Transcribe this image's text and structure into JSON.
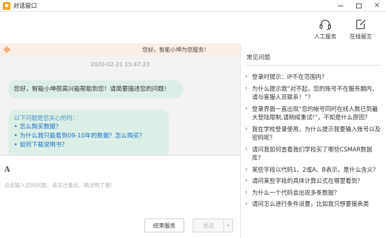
{
  "window": {
    "title": "对话窗口",
    "controls": [
      "minimize",
      "maximize",
      "close"
    ]
  },
  "header": {
    "manual_service_label": "人工服务",
    "leave_message_label": "在线留言"
  },
  "chat": {
    "notice": "您好，智能小坤为您服务！",
    "timestamp": "2020-02-21 15:47:23",
    "welcome": "您好，智能小坤很高兴能帮助到您！请简要描述您的问题！",
    "faq_title": "以下问题是您关心的吗：",
    "faq_links": [
      "怎么购买数据？",
      "为什么我只能看到09-10年的数据？怎么购买？",
      "如何下载说明书？"
    ]
  },
  "input": {
    "font_icon": "A",
    "placeholder": "点此输入您的问题，请突出重点，简洁明了哦！",
    "end_button": "结束服务",
    "send_button": "发送"
  },
  "faq_panel": {
    "title": "常见问题",
    "items": [
      "登录时提示：IP不在范围内？",
      "为什么提示我“对不起，您的账号不在服务期内，请与客服人员联系！”？",
      "登录界面一直出现“您的帐号同时在线人数已到最大登陆限制,请稍候重试!”，不知是什么原因?",
      "我在学校登录使用，为什么提示我要输入账号以及密码呢？",
      "请问我如何查看我们学校买了哪些CSMAR数据库？",
      "某些字段以代码1、2或A、B表示，是什么含义？",
      "请问某些字段的具体计算公式在哪里看到？",
      "为什么一个代码会出现多条数据？",
      "请问怎么进行条件设置，比如我只想要报表类"
    ]
  }
}
